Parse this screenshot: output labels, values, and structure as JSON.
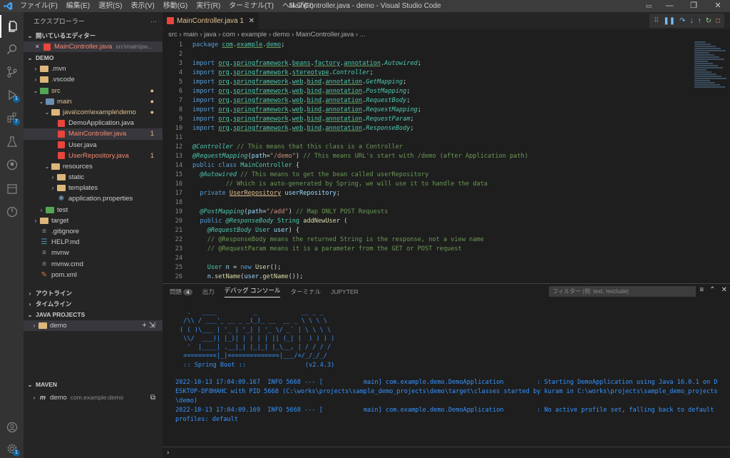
{
  "titlebar": {
    "menu": [
      "ファイル(F)",
      "編集(E)",
      "選択(S)",
      "表示(V)",
      "移動(G)",
      "実行(R)",
      "ターミナル(T)",
      "ヘルプ(H)"
    ],
    "window_title": "MainController.java - demo - Visual Studio Code",
    "controls": [
      "—",
      "❐",
      "✕"
    ]
  },
  "activity_badges": {
    "git": "1",
    "extensions": "7",
    "accounts": "1"
  },
  "sidebar": {
    "title": "エクスプローラー",
    "title_more": "···",
    "open_editors": {
      "label": "開いているエディター",
      "file": "MainController.java",
      "path": "src\\main\\jav..."
    },
    "project": "DEMO",
    "tree": [
      {
        "label": ".mvn",
        "depth": 1,
        "type": "folder",
        "twisty": "›"
      },
      {
        "label": ".vscode",
        "depth": 1,
        "type": "folder",
        "twisty": "›"
      },
      {
        "label": "src",
        "depth": 1,
        "type": "folder-green",
        "twisty": "⌄",
        "deco": "●"
      },
      {
        "label": "main",
        "depth": 2,
        "type": "folder-blue",
        "twisty": "⌄",
        "deco": "●"
      },
      {
        "label": "java\\com\\example\\demo",
        "depth": 3,
        "type": "folder",
        "twisty": "⌄",
        "deco": "●"
      },
      {
        "label": "DemoApplication.java",
        "depth": 4,
        "type": "java"
      },
      {
        "label": "MainController.java",
        "depth": 4,
        "type": "java",
        "deco": "1",
        "selected": true
      },
      {
        "label": "User.java",
        "depth": 4,
        "type": "java"
      },
      {
        "label": "UserRepository.java",
        "depth": 4,
        "type": "java",
        "deco": "1"
      },
      {
        "label": "resources",
        "depth": 3,
        "type": "folder",
        "twisty": "⌄"
      },
      {
        "label": "static",
        "depth": 4,
        "type": "folder",
        "twisty": "›"
      },
      {
        "label": "templates",
        "depth": 4,
        "type": "folder",
        "twisty": "›"
      },
      {
        "label": "application.properties",
        "depth": 4,
        "type": "gear"
      },
      {
        "label": "test",
        "depth": 2,
        "type": "folder-green",
        "twisty": "›"
      },
      {
        "label": "target",
        "depth": 1,
        "type": "folder",
        "twisty": "›"
      },
      {
        "label": ".gitignore",
        "depth": 1,
        "type": "file"
      },
      {
        "label": "HELP.md",
        "depth": 1,
        "type": "md"
      },
      {
        "label": "mvnw",
        "depth": 1,
        "type": "file"
      },
      {
        "label": "mvnw.cmd",
        "depth": 1,
        "type": "file"
      },
      {
        "label": "pom.xml",
        "depth": 1,
        "type": "xml"
      }
    ],
    "outline": "アウトライン",
    "timeline": "タイムライン",
    "java_projects": "JAVA PROJECTS",
    "java_project_item": "demo",
    "maven": "MAVEN",
    "maven_item": "demo",
    "maven_item_detail": "com.example:demo"
  },
  "editor": {
    "tab_label": "MainController.java 1",
    "tab_close": "✕",
    "breadcrumb": "src  ›  main  ›  java  ›  com  ›  example  ›  demo  ›  MainController.java  ›  ...",
    "debug_toolbar": [
      "⠿",
      "❚❚",
      "↷",
      "↓",
      "↑",
      "↻",
      "□"
    ]
  },
  "code_lines": [
    {
      "n": "1",
      "html": "<span class='kw'>package</span> <span class='pk'>com</span>.<span class='pk'>example</span>.<span class='pk'>demo</span>;"
    },
    {
      "n": "2",
      "html": ""
    },
    {
      "n": "3",
      "html": "<span class='kw'>import</span> <span class='pk'>org</span>.<span class='pk'>springframework</span>.<span class='pk'>beans</span>.<span class='pk'>factory</span>.<span class='pk'>annotation</span>.<span class='an'>Autowired</span>;"
    },
    {
      "n": "4",
      "html": "<span class='kw'>import</span> <span class='pk'>org</span>.<span class='pk'>springframework</span>.<span class='pk'>stereotype</span>.<span class='an'>Controller</span>;"
    },
    {
      "n": "5",
      "html": "<span class='kw'>import</span> <span class='pk'>org</span>.<span class='pk'>springframework</span>.<span class='pk'>web</span>.<span class='pk'>bind</span>.<span class='pk'>annotation</span>.<span class='an'>GetMapping</span>;"
    },
    {
      "n": "6",
      "html": "<span class='kw'>import</span> <span class='pk'>org</span>.<span class='pk'>springframework</span>.<span class='pk'>web</span>.<span class='pk'>bind</span>.<span class='pk'>annotation</span>.<span class='an'>PostMapping</span>;"
    },
    {
      "n": "7",
      "html": "<span class='kw'>import</span> <span class='pk'>org</span>.<span class='pk'>springframework</span>.<span class='pk'>web</span>.<span class='pk'>bind</span>.<span class='pk'>annotation</span>.<span class='an'>RequestBody</span>;"
    },
    {
      "n": "8",
      "html": "<span class='kw'>import</span> <span class='pk'>org</span>.<span class='pk'>springframework</span>.<span class='pk'>web</span>.<span class='pk'>bind</span>.<span class='pk'>annotation</span>.<span class='an'>RequestMapping</span>;"
    },
    {
      "n": "9",
      "html": "<span class='kw'>import</span> <span class='pk'>org</span>.<span class='pk'>springframework</span>.<span class='pk'>web</span>.<span class='pk'>bind</span>.<span class='pk'>annotation</span>.<span class='an'>RequestParam</span>;"
    },
    {
      "n": "10",
      "html": "<span class='kw'>import</span> <span class='pk'>org</span>.<span class='pk'>springframework</span>.<span class='pk'>web</span>.<span class='pk'>bind</span>.<span class='pk'>annotation</span>.<span class='an'>ResponseBody</span>;"
    },
    {
      "n": "11",
      "html": ""
    },
    {
      "n": "12",
      "html": "<span class='an'>@Controller</span> <span class='cm'>// This means that this class is a Controller</span>"
    },
    {
      "n": "13",
      "html": "<span class='an'>@RequestMapping</span>(<span class='id'>path</span>=<span class='str'>\"/demo\"</span>) <span class='cm'>// This means URL's start with /demo (after Application path)</span>"
    },
    {
      "n": "14",
      "html": "<span class='kw'>public</span> <span class='kw'>class</span> <span class='ty'>MainController</span> {"
    },
    {
      "n": "15",
      "html": "  <span class='an'>@Autowired</span> <span class='cm'>// This means to get the bean called userRepository</span>"
    },
    {
      "n": "16",
      "html": "         <span class='cm'>// Which is auto-generated by Spring, we will use it to handle the data</span>"
    },
    {
      "n": "17",
      "html": "  <span class='kw'>private</span> <span class='lnk'>UserRepository</span> <span class='id'>userRepository</span>;"
    },
    {
      "n": "18",
      "html": ""
    },
    {
      "n": "19",
      "html": "  <span class='an'>@PostMapping</span>(<span class='id'>path</span>=<span class='str'>\"/add\"</span>) <span class='cm'>// Map ONLY POST Requests</span>"
    },
    {
      "n": "20",
      "html": "  <span class='kw'>public</span> <span class='an'>@ResponseBody</span> <span class='ty'>String</span> <span class='fn'>addNewUser</span> ("
    },
    {
      "n": "21",
      "html": "    <span class='an'>@RequestBody</span> <span class='ty'>User</span> <span class='id'>user</span>) {"
    },
    {
      "n": "22",
      "html": "    <span class='cm'>// @ResponseBody means the returned String is the response, not a view name</span>"
    },
    {
      "n": "23",
      "html": "    <span class='cm'>// @RequestParam means it is a parameter from the GET or POST request</span>"
    },
    {
      "n": "24",
      "html": ""
    },
    {
      "n": "25",
      "html": "    <span class='ty'>User</span> <span class='id'>n</span> = <span class='kw'>new</span> <span class='fn'>User</span>();"
    },
    {
      "n": "26",
      "html": "    <span class='id'>n</span>.<span class='fn'>setName</span>(<span class='id'>user</span>.<span class='fn'>getName</span>());"
    }
  ],
  "panel": {
    "tabs": [
      "問題",
      "出力",
      "デバッグ コンソール",
      "ターミナル",
      "JUPYTER"
    ],
    "problems_count": "4",
    "filter_placeholder": "フィルター (例: text, !exclude)",
    "icons": [
      "≡",
      "⌃",
      "✕"
    ],
    "banner": [
      "  .   ____          _            __ _ _",
      " /\\\\ / ___'_ __ _ _(_)_ __  __ _ \\ \\ \\ \\",
      "( ( )\\___ | '_ | '_| | '_ \\/ _` | \\ \\ \\ \\",
      " \\\\/  ___)| |_)| | | | | || (_| |  ) ) ) )",
      "  '  |____| .__|_| |_|_| |_\\__, | / / / /",
      " =========|_|==============|___/=/_/_/_/",
      " :: Spring Boot ::                (v2.4.3)"
    ],
    "log": [
      "2022-10-13 17:04:09.167  INFO 5668 --- [           main] com.example.demo.DemoApplication         : Starting DemoApplication using Java 16.0.1 on D",
      "ESKTOP-DF8HAHC with PID 5668 (C:\\works\\projects\\sample_demo_projects\\demo\\target\\classes started by kuram in C:\\works\\projects\\sample_demo_projects",
      "\\demo)",
      "2022-10-13 17:04:09.169  INFO 5668 --- [           main] com.example.demo.DemoApplication         : No active profile set, falling back to default",
      "profiles: default"
    ],
    "repl_prompt": "›"
  }
}
